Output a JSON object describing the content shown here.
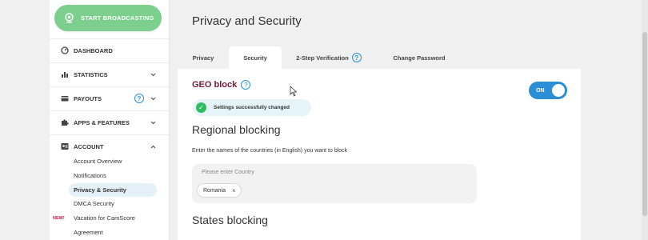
{
  "sidebar": {
    "broadcast_label": "START BROADCASTING",
    "items": [
      {
        "label": "DASHBOARD"
      },
      {
        "label": "STATISTICS"
      },
      {
        "label": "PAYOUTS"
      },
      {
        "label": "APPS & FEATURES"
      },
      {
        "label": "ACCOUNT"
      }
    ],
    "account_sub": [
      {
        "label": "Account Overview"
      },
      {
        "label": "Notifications"
      },
      {
        "label": "Privacy & Security"
      },
      {
        "label": "DMCA Security"
      },
      {
        "label": "Vacation for CamScore",
        "badge": "NEW!"
      },
      {
        "label": "Agreement"
      }
    ]
  },
  "page": {
    "title": "Privacy and Security",
    "tabs": [
      {
        "label": "Privacy"
      },
      {
        "label": "Security"
      },
      {
        "label": "2-Step Verification"
      },
      {
        "label": "Change Password"
      }
    ]
  },
  "geo": {
    "title": "GEO block",
    "toggle_label": "ON",
    "success_msg": "Settings successfully changed"
  },
  "regional": {
    "title": "Regional blocking",
    "helper": "Enter the names of the countries (in English) you want to block",
    "placeholder": "Please enter Country",
    "chips": [
      "Romania"
    ]
  },
  "states": {
    "title": "States blocking"
  },
  "colors": {
    "broadcast_green": "#7ccf8c",
    "accent_blue": "#2a8fd4",
    "geo_title": "#7b1936",
    "success_check": "#2ebd5e"
  }
}
